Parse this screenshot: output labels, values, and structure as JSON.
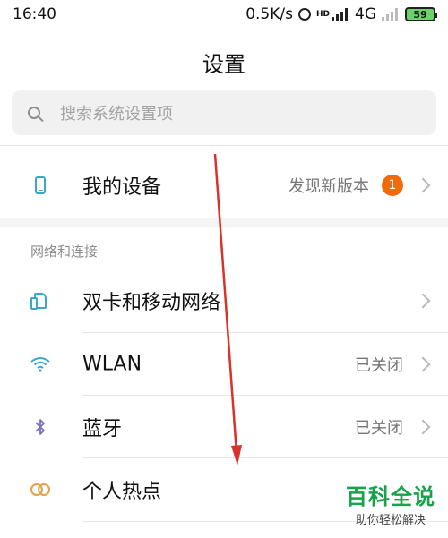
{
  "status_bar": {
    "time": "16:40",
    "speed": "0.5K/s",
    "hd_label": "HD",
    "network": "4G",
    "battery": "59"
  },
  "header": {
    "title": "设置"
  },
  "search": {
    "placeholder": "搜索系统设置项"
  },
  "my_device": {
    "label": "我的设备",
    "value": "发现新版本",
    "badge": "1"
  },
  "network_section": {
    "header": "网络和连接",
    "items": [
      {
        "label": "双卡和移动网络",
        "value": "",
        "icon": "sim-card-icon"
      },
      {
        "label": "WLAN",
        "value": "已关闭",
        "icon": "wifi-icon"
      },
      {
        "label": "蓝牙",
        "value": "已关闭",
        "icon": "bluetooth-icon"
      },
      {
        "label": "个人热点",
        "value": "",
        "icon": "hotspot-icon"
      }
    ]
  },
  "colors": {
    "accent_blue": "#3aa7c9",
    "badge_orange": "#f36a0e",
    "annotation_red": "#d9322b",
    "watermark_green": "#1aa24a"
  },
  "watermark": {
    "title": "百科全说",
    "subtitle": "助你轻松解决"
  }
}
